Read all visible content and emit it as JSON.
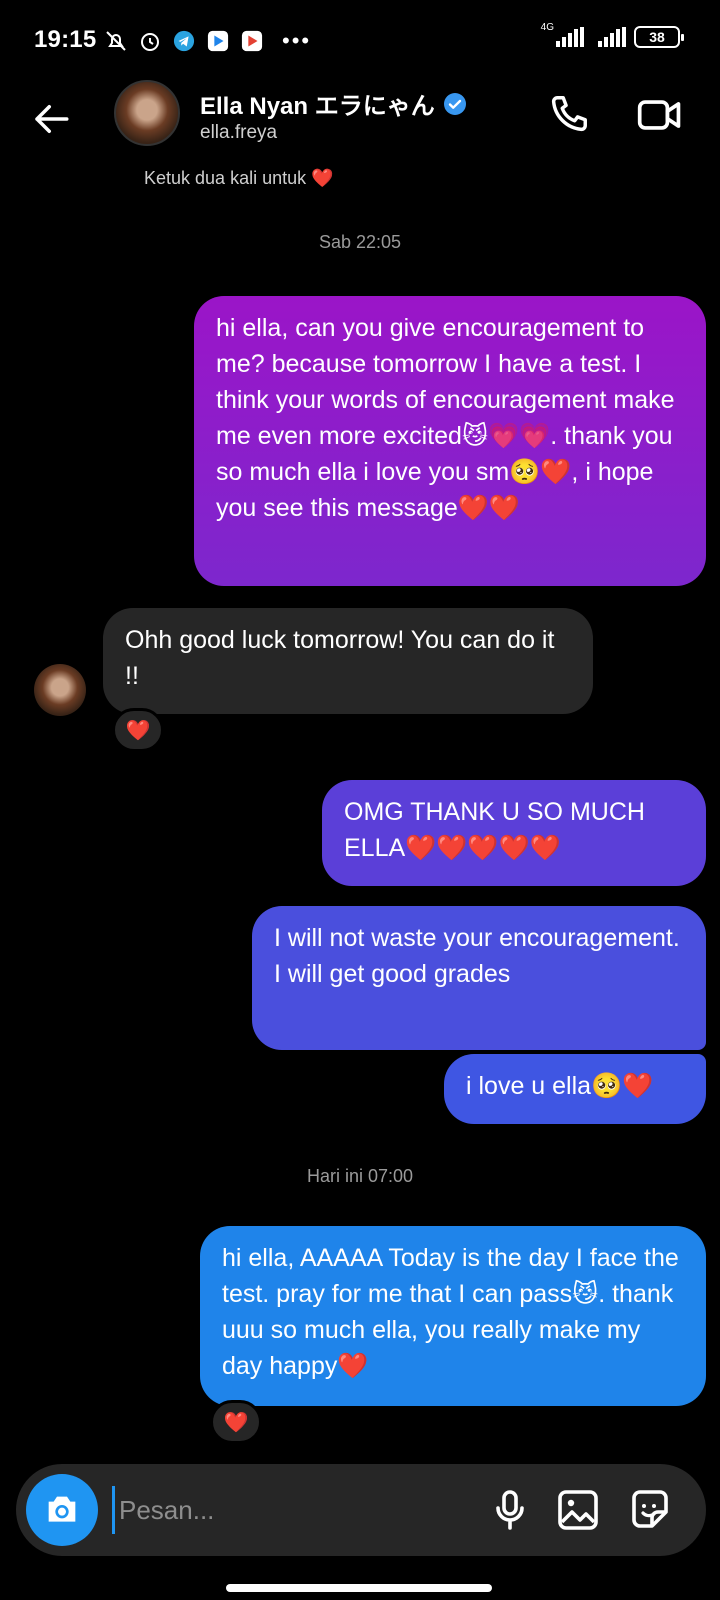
{
  "status_bar": {
    "time": "19:15",
    "network": "4G",
    "battery": "38"
  },
  "header": {
    "name": "Ella Nyan エラにゃん",
    "username": "ella.freya"
  },
  "hint": "Ketuk dua kali untuk ❤️",
  "timestamps": [
    "Sab 22:05",
    "Hari ini 07:00"
  ],
  "messages": [
    {
      "text": "hi ella, can you give encouragement to me? because tomorrow I have a test. I think your words of encouragement make me even more excited😼💗💗. thank you so much ella i love you sm🥺❤️, i hope you see this message❤️❤️"
    },
    {
      "text": "Ohh good luck tomorrow! You can do it !!"
    },
    {
      "text": "OMG THANK U SO MUCH ELLA❤️❤️❤️❤️❤️"
    },
    {
      "text": "I will not waste your encouragement. I will get good grades"
    },
    {
      "text": "i love u ella🥺❤️"
    },
    {
      "text": "hi ella, AAAAA Today is the day I face the test. pray for me that I can pass😼. thank uuu so much ella, you really make my day happy❤️"
    }
  ],
  "reactions": [
    "❤️",
    "❤️"
  ],
  "composer": {
    "placeholder": "Pesan..."
  },
  "colors": {
    "accent": "#1f95f2",
    "bubble_purple": "#9b15c8",
    "bubble_blue": "#1f84ea",
    "incoming_bubble": "#262626",
    "verified": "#3897f0"
  }
}
